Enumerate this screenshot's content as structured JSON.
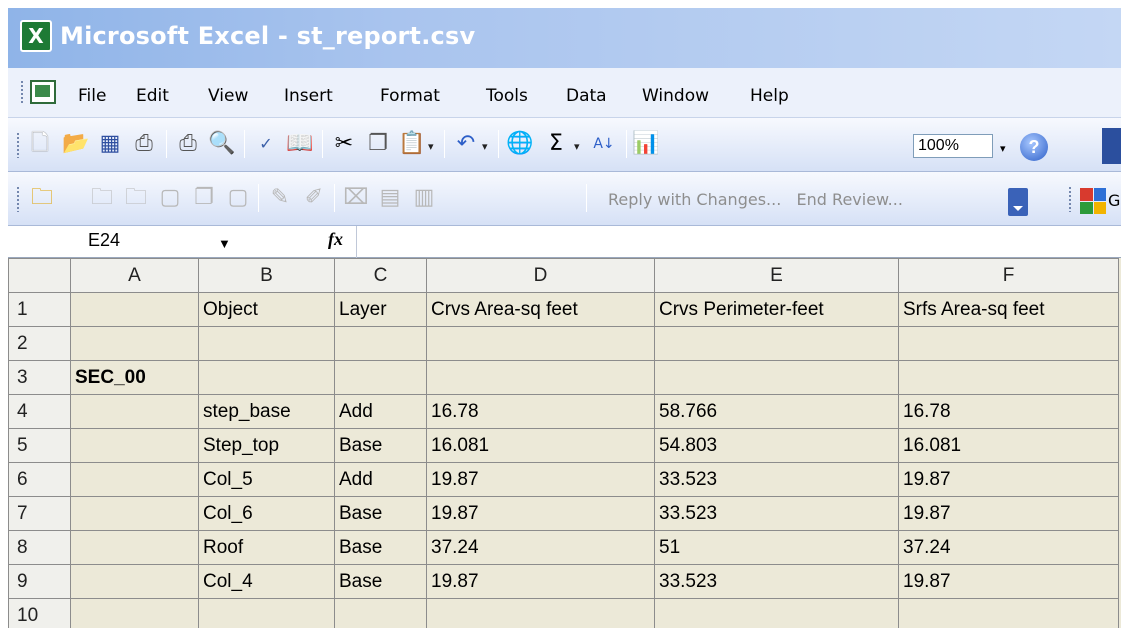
{
  "window": {
    "title": "Microsoft Excel - st_report.csv",
    "app_icon": "excel-icon"
  },
  "menu": [
    "File",
    "Edit",
    "View",
    "Insert",
    "Format",
    "Tools",
    "Data",
    "Window",
    "Help"
  ],
  "toolbar": {
    "zoom": "100%",
    "sigma": "Σ",
    "reply_label": "Reply with Changes...",
    "end_review_label": "End Review...",
    "google_partial": "Go"
  },
  "formula_bar": {
    "name_box": "E24",
    "fx_label": "fx",
    "formula": ""
  },
  "grid": {
    "columns": [
      "A",
      "B",
      "C",
      "D",
      "E",
      "F"
    ],
    "rows": [
      {
        "num": "1",
        "cells": [
          "",
          "Object",
          "Layer",
          "Crvs Area-sq feet",
          "Crvs Perimeter-feet",
          "Srfs Area-sq feet"
        ]
      },
      {
        "num": "2",
        "cells": [
          "",
          "",
          "",
          "",
          "",
          ""
        ]
      },
      {
        "num": "3",
        "cells": [
          "SEC_00",
          "",
          "",
          "",
          "",
          ""
        ]
      },
      {
        "num": "4",
        "cells": [
          "",
          "step_base",
          "Add",
          "16.78",
          "58.766",
          "16.78"
        ]
      },
      {
        "num": "5",
        "cells": [
          "",
          "Step_top",
          "Base",
          "16.081",
          "54.803",
          "16.081"
        ]
      },
      {
        "num": "6",
        "cells": [
          "",
          "Col_5",
          "Add",
          "19.87",
          "33.523",
          "19.87"
        ]
      },
      {
        "num": "7",
        "cells": [
          "",
          "Col_6",
          "Base",
          "19.87",
          "33.523",
          "19.87"
        ]
      },
      {
        "num": "8",
        "cells": [
          "",
          "Roof",
          "Base",
          "37.24",
          "51",
          "37.24"
        ]
      },
      {
        "num": "9",
        "cells": [
          "",
          "Col_4",
          "Base",
          "19.87",
          "33.523",
          "19.87"
        ]
      },
      {
        "num": "10",
        "cells": [
          "",
          "",
          "",
          "",
          "",
          ""
        ]
      }
    ]
  },
  "colors": {
    "title_gradient_start": "#8fb4e8",
    "menubar_bg": "#ecf1fb",
    "header_bg": "#f0f0ec"
  }
}
